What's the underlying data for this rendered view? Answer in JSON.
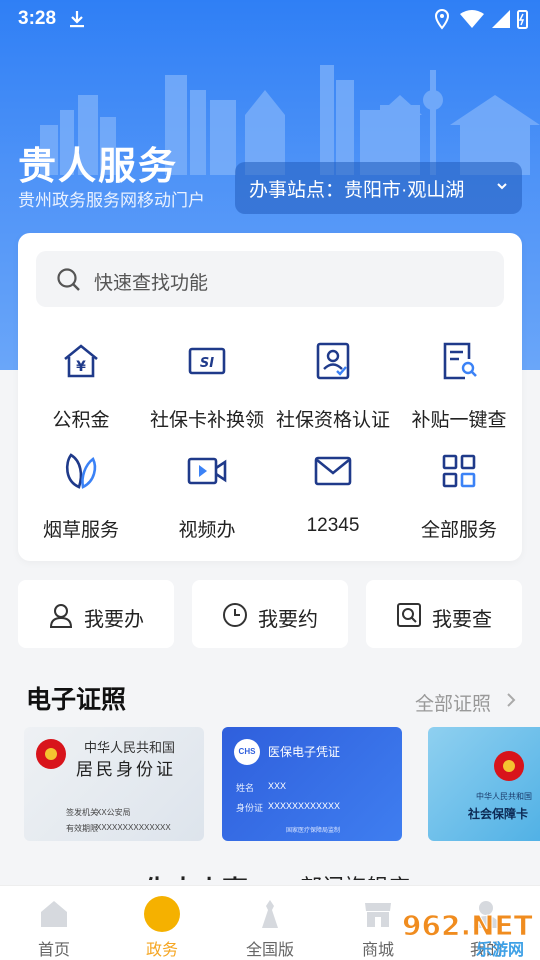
{
  "status_bar": {
    "time": "3:28"
  },
  "hero": {
    "title": "贵人服务",
    "subtitle": "贵州政务服务网移动门户",
    "station_label": "办事站点：贵阳市·观山湖"
  },
  "search": {
    "placeholder": "快速查找功能"
  },
  "services": [
    {
      "label": "公积金",
      "icon": "housing-fund-icon"
    },
    {
      "label": "社保卡补换领",
      "icon": "si-card-icon"
    },
    {
      "label": "社保资格认证",
      "icon": "qualification-icon"
    },
    {
      "label": "补贴一键查",
      "icon": "subsidy-search-icon"
    },
    {
      "label": "烟草服务",
      "icon": "tobacco-leaf-icon"
    },
    {
      "label": "视频办",
      "icon": "video-camera-icon"
    },
    {
      "label": "12345",
      "icon": "mail-icon"
    },
    {
      "label": "全部服务",
      "icon": "grid-icon"
    }
  ],
  "quick_actions": [
    {
      "label": "我要办",
      "icon": "person-icon"
    },
    {
      "label": "我要约",
      "icon": "clock-icon"
    },
    {
      "label": "我要查",
      "icon": "search-doc-icon"
    }
  ],
  "certificates": {
    "title": "电子证照",
    "more": "全部证照",
    "id_card": {
      "country": "中华人民共和国",
      "name": "居民身份证",
      "issuer_label": "签发机关",
      "issuer": "XX公安局",
      "validity_label": "有效期限",
      "validity": "XXXXXXXXXXXXXX"
    },
    "medical": {
      "badge": "CHS",
      "title": "医保电子凭证",
      "name_label": "姓名",
      "name": "XXX",
      "id_label": "身份证",
      "id": "XXXXXXXXXXXX",
      "footer": "国家医疗保障局监制"
    },
    "social": {
      "country": "中华人民共和国",
      "name": "社会保障卡"
    }
  },
  "next_section": {
    "left": "一生大小事",
    "right": "部门旗舰店"
  },
  "tabs": [
    {
      "label": "首页",
      "icon": "home-icon"
    },
    {
      "label": "政务",
      "icon": "gov-affairs-icon",
      "active": true
    },
    {
      "label": "全国版",
      "icon": "national-icon"
    },
    {
      "label": "商城",
      "icon": "shop-icon"
    },
    {
      "label": "我的",
      "icon": "profile-icon"
    }
  ],
  "watermark": {
    "text": "962.NET",
    "sub": "乐游网"
  },
  "colors": {
    "primary": "#2f7ff5",
    "active_tab": "#f5a623",
    "icon_blue": "#1f3a8a"
  }
}
